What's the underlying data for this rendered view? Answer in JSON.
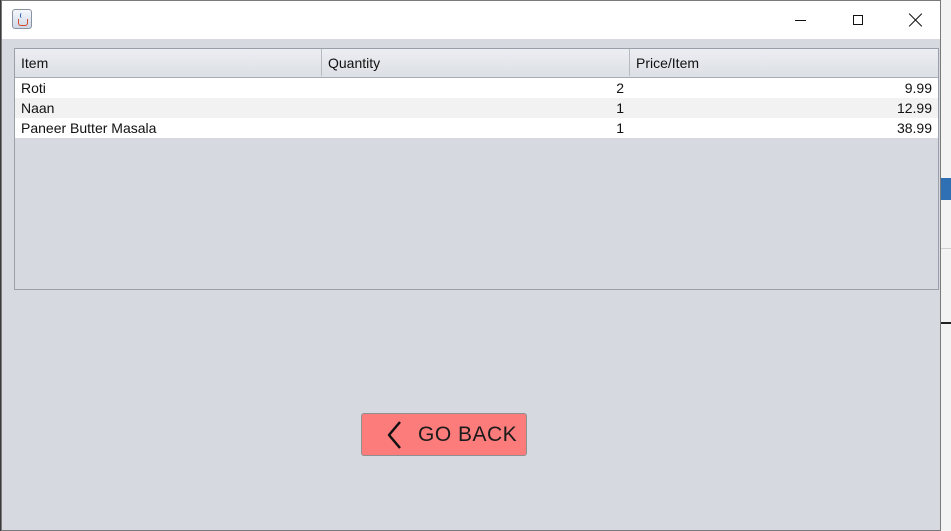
{
  "window": {
    "title": "",
    "app_icon": "java-coffee-cup-icon"
  },
  "titlebar_buttons": {
    "minimize_icon": "minimize-icon",
    "maximize_icon": "maximize-icon",
    "close_icon": "close-icon"
  },
  "order_table": {
    "columns": [
      "Item",
      "Quantity",
      "Price/Item"
    ],
    "rows": [
      {
        "item": "Roti",
        "quantity": "2",
        "price": "9.99"
      },
      {
        "item": "Naan",
        "quantity": "1",
        "price": "12.99"
      },
      {
        "item": "Paneer Butter Masala",
        "quantity": "1",
        "price": "38.99"
      }
    ]
  },
  "go_back_button": {
    "label": "GO BACK",
    "icon": "chevron-left-icon",
    "color": "#fc7c7c"
  }
}
